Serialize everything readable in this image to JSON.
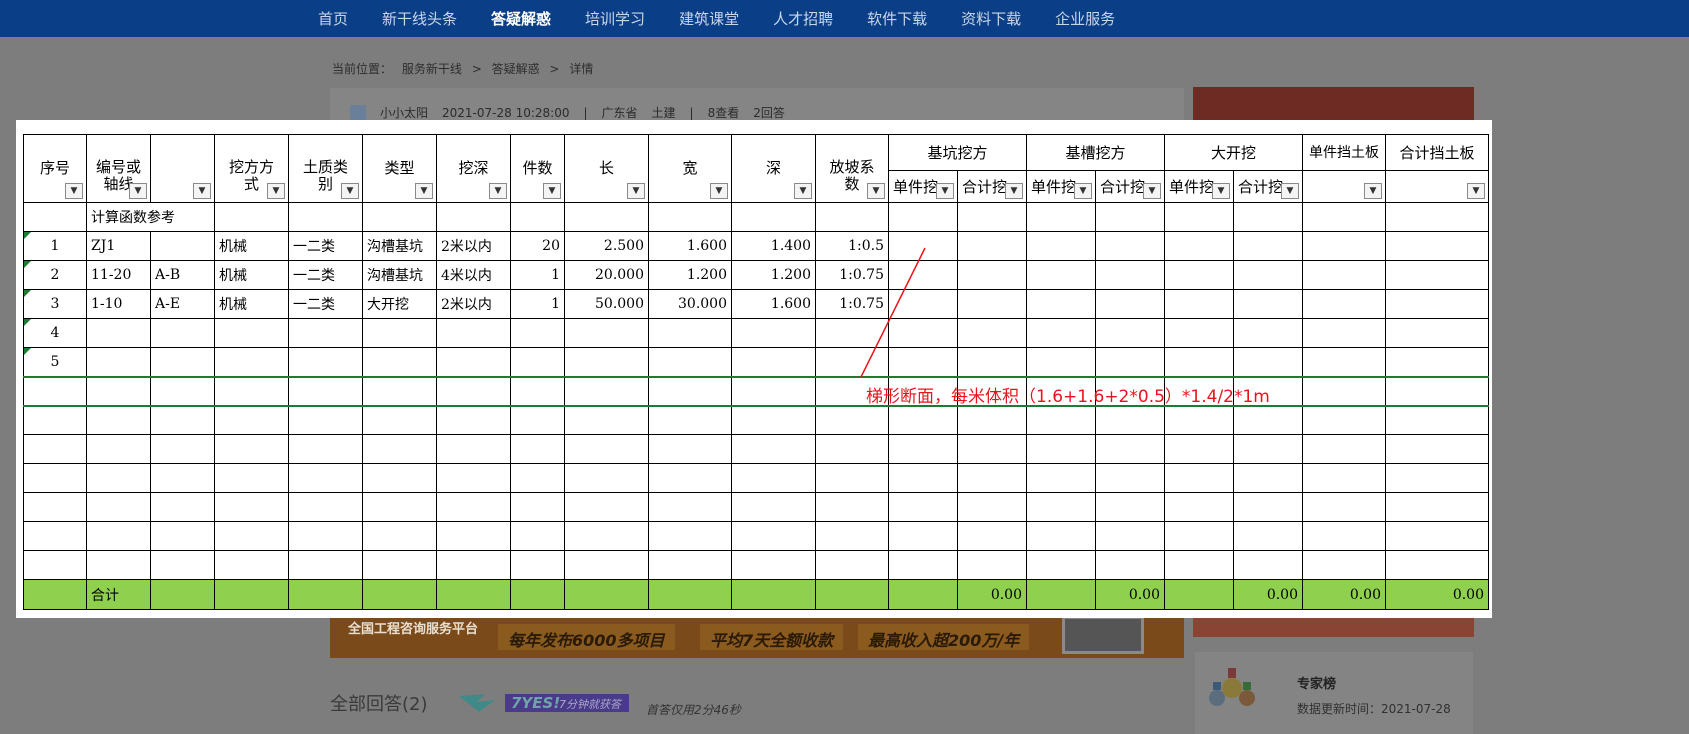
{
  "nav": {
    "items": [
      "首页",
      "新干线头条",
      "答疑解惑",
      "培训学习",
      "建筑课堂",
      "人才招聘",
      "软件下载",
      "资料下载",
      "企业服务"
    ],
    "active_index": 2
  },
  "breadcrumb": {
    "label": "当前位置：",
    "items": [
      "服务新干线",
      ">",
      "答疑解惑",
      ">",
      "详情"
    ]
  },
  "question_meta": {
    "user": "小小太阳",
    "datetime": "2021-07-28 10:28:00",
    "sep1": "|",
    "region": "广东省",
    "category": "土建",
    "sep2": "|",
    "views": "8查看",
    "answers": "2回答"
  },
  "banner": {
    "left_text": "全国工程咨询服务平台",
    "pill1": "每年发布6000多项目",
    "pill2": "平均7天全额收款",
    "pill3": "最高收入超200万/年"
  },
  "answers": {
    "title": "全部回答(2)",
    "yes_logo": "7YES!",
    "yes_tag": "7分钟就获答",
    "first_answer_time": "首答仅用2分46秒"
  },
  "expert": {
    "title": "专家榜",
    "updated": "数据更新时间：2021-07-28"
  },
  "sheet": {
    "header_row1": {
      "seq": "序号",
      "code": "编号或轴线",
      "blank": "",
      "method": "挖方方式",
      "soil": "土质类别",
      "type": "类型",
      "depth_range": "挖深",
      "count": "件数",
      "length": "长",
      "width": "宽",
      "depth": "深",
      "slope": "放坡系数",
      "pit": "基坑挖方",
      "trench": "基槽挖方",
      "open": "大开挖",
      "board_unit": "单件挡土板",
      "board_total": "合计挡土板"
    },
    "header_row2": {
      "pit_unit": "单件挖",
      "pit_total": "合计挖",
      "trench_unit": "单件挖",
      "trench_total": "合计挖",
      "open_unit": "单件挖",
      "open_total": "合计挖"
    },
    "ref_row_label": "计算函数参考",
    "rows": [
      {
        "seq": "1",
        "code": "ZJ1",
        "axis": "",
        "method": "机械",
        "soil": "一二类",
        "type": "沟槽基坑",
        "depth_range": "2米以内",
        "count": "20",
        "length": "2.500",
        "width": "1.600",
        "depth": "1.400",
        "slope": "1:0.5"
      },
      {
        "seq": "2",
        "code": "11-20",
        "axis": "A-B",
        "method": "机械",
        "soil": "一二类",
        "type": "沟槽基坑",
        "depth_range": "4米以内",
        "count": "1",
        "length": "20.000",
        "width": "1.200",
        "depth": "1.200",
        "slope": "1:0.75"
      },
      {
        "seq": "3",
        "code": "1-10",
        "axis": "A-E",
        "method": "机械",
        "soil": "一二类",
        "type": "大开挖",
        "depth_range": "2米以内",
        "count": "1",
        "length": "50.000",
        "width": "30.000",
        "depth": "1.600",
        "slope": "1:0.75"
      },
      {
        "seq": "4"
      },
      {
        "seq": "5"
      }
    ],
    "total_row": {
      "label": "合计",
      "pit_total": "0.00",
      "trench_total": "0.00",
      "open_total": "0.00",
      "board_unit": "0.00",
      "board_total": "0.00"
    },
    "filter_glyph": "▼",
    "annotation": "梯形断面，每米体积（1.6+1.6+2*0.5）*1.4/2*1m",
    "annotation_color": "#e8141c",
    "total_color": "#8fd14f"
  }
}
